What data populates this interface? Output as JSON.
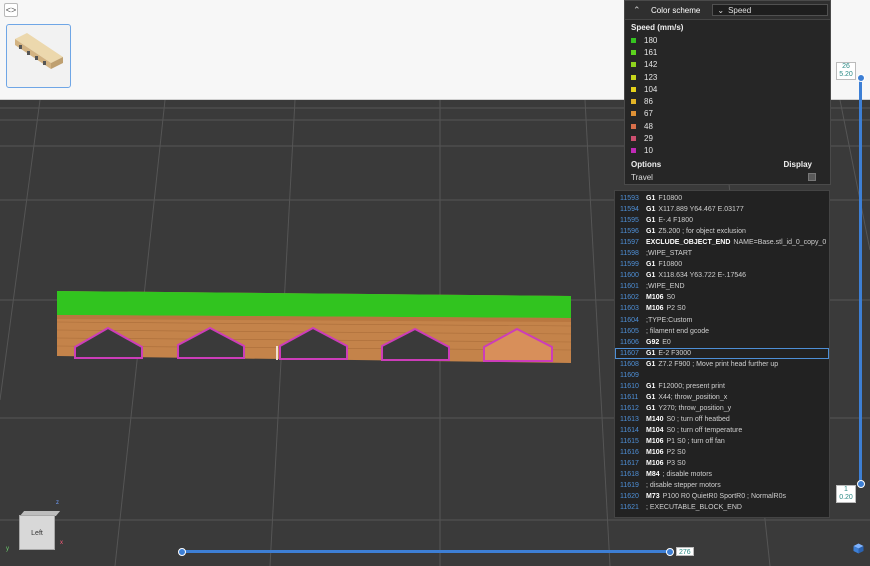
{
  "legend": {
    "color_scheme_label": "Color scheme",
    "scheme_value": "Speed",
    "title": "Speed (mm/s)",
    "items": [
      {
        "value": "180",
        "color": "#35c420"
      },
      {
        "value": "161",
        "color": "#5cd11e"
      },
      {
        "value": "142",
        "color": "#8fd31d"
      },
      {
        "value": "123",
        "color": "#c7d61c"
      },
      {
        "value": "104",
        "color": "#e6d21a"
      },
      {
        "value": "86",
        "color": "#e3b426"
      },
      {
        "value": "67",
        "color": "#df9135"
      },
      {
        "value": "48",
        "color": "#d86f4a"
      },
      {
        "value": "29",
        "color": "#cc4f6f"
      },
      {
        "value": "10",
        "color": "#c02ab6"
      }
    ],
    "options_label": "Options",
    "display_label": "Display",
    "travel_label": "Travel"
  },
  "gcode": {
    "active_index": 14,
    "lines": [
      {
        "num": "11593",
        "cmd": "G1",
        "args": "F10800"
      },
      {
        "num": "11594",
        "cmd": "G1",
        "args": "X117.889 Y64.467 E.03177"
      },
      {
        "num": "11595",
        "cmd": "G1",
        "args": "E-.4 F1800"
      },
      {
        "num": "11596",
        "cmd": "G1",
        "args": "Z5.200 ; for object exclusion"
      },
      {
        "num": "11597",
        "cmd": "EXCLUDE_OBJECT_END",
        "args": "NAME=Base.stl_id_0_copy_0"
      },
      {
        "num": "11598",
        "cmd": "",
        "args": ";WIPE_START"
      },
      {
        "num": "11599",
        "cmd": "G1",
        "args": "F10800"
      },
      {
        "num": "11600",
        "cmd": "G1",
        "args": "X118.634 Y63.722 E-.17546"
      },
      {
        "num": "11601",
        "cmd": "",
        "args": ";WIPE_END"
      },
      {
        "num": "11602",
        "cmd": "M106",
        "args": "S0"
      },
      {
        "num": "11603",
        "cmd": "M106",
        "args": "P2 S0"
      },
      {
        "num": "11604",
        "cmd": "",
        "args": ";TYPE:Custom"
      },
      {
        "num": "11605",
        "cmd": "",
        "args": "; filament end gcode"
      },
      {
        "num": "11606",
        "cmd": "G92",
        "args": "E0"
      },
      {
        "num": "11607",
        "cmd": "G1",
        "args": "E-2 F3000"
      },
      {
        "num": "11608",
        "cmd": "G1",
        "args": "Z7.2 F900 ; Move print head further up"
      },
      {
        "num": "11609",
        "cmd": "",
        "args": ""
      },
      {
        "num": "11610",
        "cmd": "G1",
        "args": "F12000; present print"
      },
      {
        "num": "11611",
        "cmd": "G1",
        "args": "X44;  throw_position_x"
      },
      {
        "num": "11612",
        "cmd": "G1",
        "args": "Y270; throw_position_y"
      },
      {
        "num": "11613",
        "cmd": "M140",
        "args": "S0 ; turn off heatbed"
      },
      {
        "num": "11614",
        "cmd": "M104",
        "args": "S0 ; turn off temperature"
      },
      {
        "num": "11615",
        "cmd": "M106",
        "args": "P1 S0 ; turn off fan"
      },
      {
        "num": "11616",
        "cmd": "M106",
        "args": "P2 S0"
      },
      {
        "num": "11617",
        "cmd": "M106",
        "args": "P3 S0"
      },
      {
        "num": "11618",
        "cmd": "M84",
        "args": "; disable motors"
      },
      {
        "num": "11619",
        "cmd": "",
        "args": "; disable stepper motors"
      },
      {
        "num": "11620",
        "cmd": "M73",
        "args": "P100 R0 QuietR0 SportR0 ; NormalR0s"
      },
      {
        "num": "11621",
        "cmd": "",
        "args": "; EXECUTABLE_BLOCK_END"
      }
    ]
  },
  "layer_slider": {
    "top_layer": "26",
    "top_height": "5.20",
    "bottom_layer": "1",
    "bottom_height": "0.20"
  },
  "move_slider": {
    "value": "276"
  },
  "view_cube": {
    "face_label": "Left",
    "axis_x": "x",
    "axis_y": "y",
    "axis_z": "z"
  },
  "colors": {
    "accent": "#3d7fd5",
    "model_top": "#35c420",
    "model_wall": "#c8864d",
    "gcode_line_number": "#4e8fd6"
  },
  "icons": {
    "collapse": "collapse-sidebar-icon",
    "legend_toggle": "chevron-up-icon",
    "view_cube": "cube-icon"
  }
}
